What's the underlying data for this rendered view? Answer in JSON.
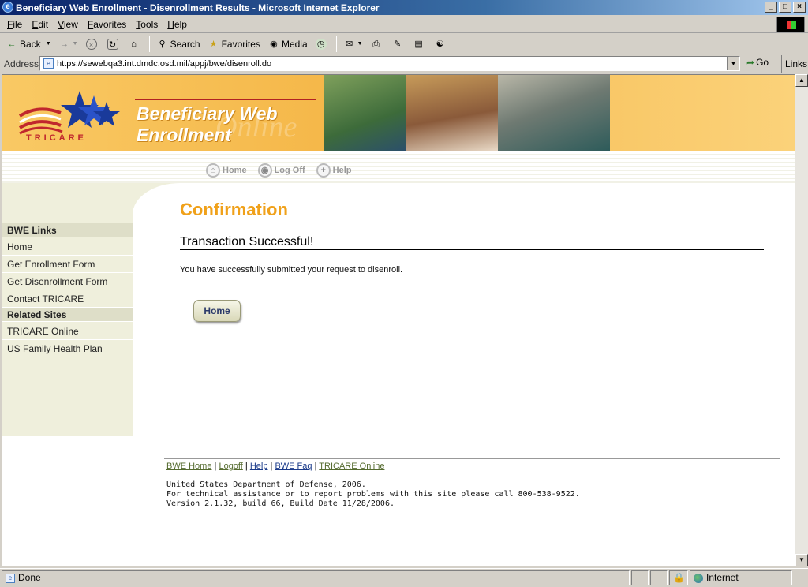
{
  "window": {
    "title": "Beneficiary Web Enrollment - Disenrollment Results - Microsoft Internet Explorer",
    "minimize": "_",
    "maximize": "□",
    "close": "×"
  },
  "menu": {
    "items": [
      {
        "u": "F",
        "rest": "ile"
      },
      {
        "u": "E",
        "rest": "dit"
      },
      {
        "u": "V",
        "rest": "iew"
      },
      {
        "u": "F",
        "rest": "avorites"
      },
      {
        "u": "T",
        "rest": "ools"
      },
      {
        "u": "H",
        "rest": "elp"
      }
    ]
  },
  "toolbar": {
    "back": "Back",
    "search": "Search",
    "favorites": "Favorites",
    "media": "Media"
  },
  "address": {
    "label": "Address",
    "url": "https://sewebqa3.int.dmdc.osd.mil/appj/bwe/disenroll.do",
    "go": "Go",
    "links": "Links"
  },
  "banner": {
    "logo_text": "TRICARE",
    "title_line1": "Beneficiary Web",
    "title_line2": "Enrollment",
    "watermark": "Online"
  },
  "topnav": {
    "home": "Home",
    "logoff": "Log Off",
    "help": "Help"
  },
  "sidebar": {
    "section1": "BWE Links",
    "links1": [
      "Home",
      "Get Enrollment Form",
      "Get Disenrollment Form",
      "Contact TRICARE"
    ],
    "section2": "Related Sites",
    "links2": [
      "TRICARE Online",
      "US Family Health Plan"
    ]
  },
  "main": {
    "heading": "Confirmation",
    "subheading": "Transaction Successful!",
    "message": "You have successfully submitted your request to disenroll.",
    "home_button": "Home"
  },
  "footer": {
    "links": [
      "BWE Home",
      "Logoff",
      "Help",
      "BWE Faq",
      "TRICARE Online"
    ],
    "separator": "|",
    "line1": "United States Department of Defense, 2006.",
    "line2": "For technical assistance or to report problems with this site please call 800-538-9522.",
    "line3": "Version 2.1.32, build 66, Build Date 11/28/2006."
  },
  "status": {
    "text": "Done",
    "zone": "Internet"
  }
}
